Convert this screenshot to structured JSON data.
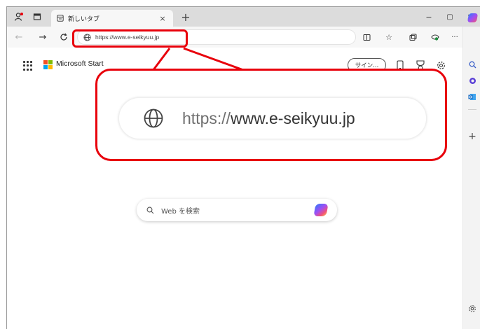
{
  "browser": {
    "tab": {
      "title": "新しいタブ",
      "close": "×"
    },
    "new_tab": "+",
    "window_controls": {
      "minimize": "−",
      "maximize": "▢",
      "close": "✕"
    },
    "address_bar": {
      "url": "https://www.e-seikyuu.jp"
    }
  },
  "page": {
    "brand": "Microsoft Start",
    "signin_label": "サイン...",
    "search_placeholder": "Web を検索"
  },
  "zoom": {
    "url_scheme": "https://",
    "url_host": "www.e-seikyuu.jp"
  },
  "colors": {
    "highlight": "#e8000b",
    "ms_red": "#f25022",
    "ms_green": "#7fba00",
    "ms_blue": "#00a4ef",
    "ms_yellow": "#ffb900"
  }
}
